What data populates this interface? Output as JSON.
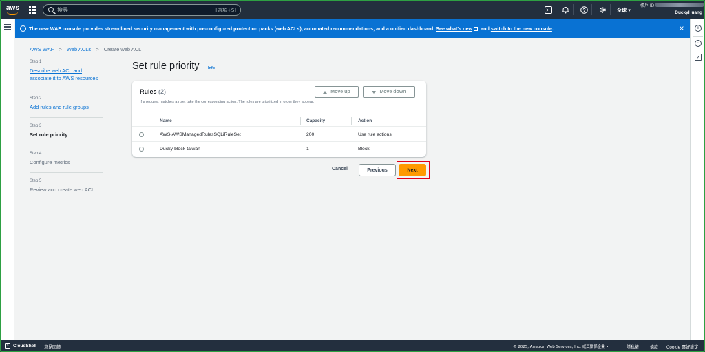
{
  "topnav": {
    "logo_text": "aws",
    "search_placeholder": "搜尋",
    "search_shortcut": "[選項+S]",
    "region": "全球 ▾",
    "account_label": "帳戶 ID:",
    "username": "DuckyHuang",
    "icons": [
      "cloudshell-icon",
      "bell-icon",
      "help-icon",
      "gear-icon"
    ]
  },
  "banner": {
    "message": "The new WAF console provides streamlined security management with pre-configured protection packs (web ACLs), automated recommendations, and a unified dashboard.",
    "link1": "See what's new",
    "connector": "and",
    "link2": "switch to the new console",
    "period": ".",
    "close": "×"
  },
  "breadcrumb": [
    {
      "label": "AWS WAF",
      "link": true
    },
    {
      "label": "Web ACLs",
      "link": true
    },
    {
      "label": "Create web ACL",
      "link": false
    }
  ],
  "steps": [
    {
      "num": "Step 1",
      "label": "Describe web ACL and associate it to AWS resources",
      "state": "link"
    },
    {
      "num": "Step 2",
      "label": "Add rules and rule groups",
      "state": "link"
    },
    {
      "num": "Step 3",
      "label": "Set rule priority",
      "state": "active"
    },
    {
      "num": "Step 4",
      "label": "Configure metrics",
      "state": "disabled"
    },
    {
      "num": "Step 5",
      "label": "Review and create web ACL",
      "state": "disabled"
    }
  ],
  "main": {
    "title": "Set rule priority",
    "info": "Info"
  },
  "rules": {
    "title": "Rules",
    "count": "(2)",
    "description": "If a request matches a rule, take the corresponding action. The rules are prioritized in order they appear.",
    "move_up": "Move up",
    "move_down": "Move down",
    "columns": [
      "Name",
      "Capacity",
      "Action"
    ],
    "rows": [
      {
        "name": "AWS-AWSManagedRulesSQLiRuleSet",
        "capacity": "200",
        "action": "Use rule actions"
      },
      {
        "name": "Ducky-block-taiwan",
        "capacity": "1",
        "action": "Block"
      }
    ]
  },
  "actions": {
    "cancel": "Cancel",
    "previous": "Previous",
    "next": "Next"
  },
  "footer": {
    "cloudshell": "CloudShell",
    "feedback": "意見回饋",
    "copyright": "© 2025, Amazon Web Services, Inc. 或其關係企業 •",
    "privacy": "隱私權",
    "terms": "條款",
    "cookie": "Cookie 喜好設定"
  },
  "colors": {
    "nav_bg": "#232f3e",
    "banner_bg": "#0972d3",
    "link": "#0972d3",
    "primary_button": "#ff9900",
    "highlight_border": "#e0001b"
  }
}
